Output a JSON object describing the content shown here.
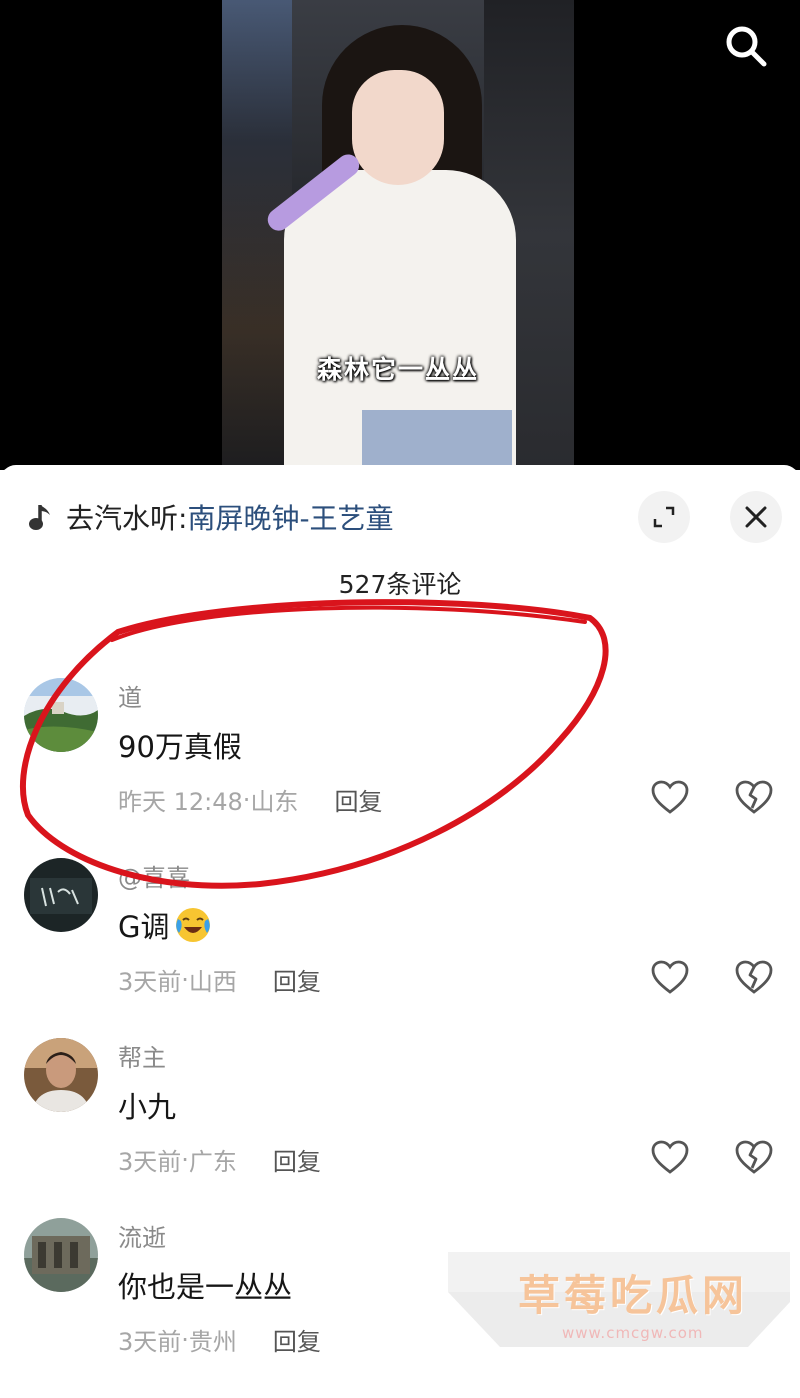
{
  "video": {
    "caption": "森林它一丛丛"
  },
  "panel": {
    "music_prefix": "去汽水听:",
    "music_title": "南屏晚钟-王艺童",
    "comment_count": "527条评论"
  },
  "comments": [
    {
      "user": "道",
      "text": "90万真假",
      "time": "昨天 12:48",
      "location": "山东",
      "reply": "回复"
    },
    {
      "user": "@喜喜",
      "text": "G调",
      "time": "3天前",
      "location": "山西",
      "reply": "回复"
    },
    {
      "user": "帮主",
      "text": "小九",
      "time": "3天前",
      "location": "广东",
      "reply": "回复"
    },
    {
      "user": "流逝",
      "text": "你也是一丛丛",
      "time": "3天前",
      "location": "贵州",
      "reply": "回复"
    }
  ],
  "meta_separator": "·",
  "icons": {
    "search": "search-icon",
    "music": "music-note-icon",
    "expand": "expand-icon",
    "close": "close-icon",
    "like": "heart-icon",
    "dislike": "broken-heart-icon",
    "emoji": "crying-laughing-emoji-icon"
  },
  "watermark": {
    "text": "草莓吃瓜网",
    "url": "www.cmcgw.com"
  },
  "colors": {
    "link": "#2c4f7c",
    "annotation": "#d9141c"
  }
}
